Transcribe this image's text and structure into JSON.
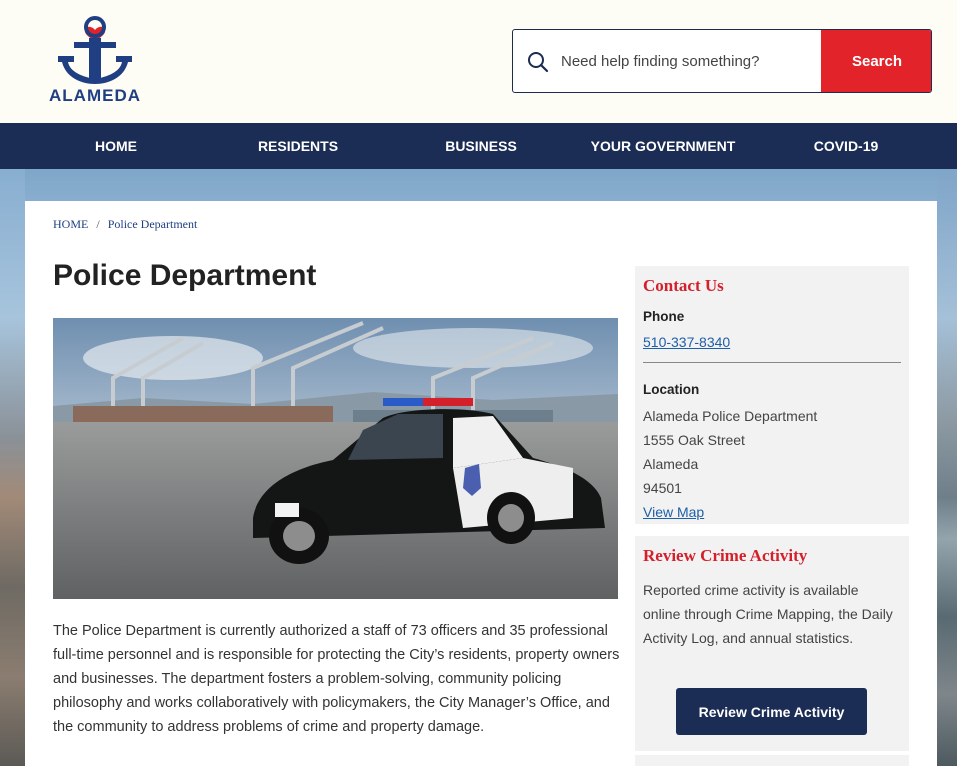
{
  "header": {
    "logo_text": "ALAMEDA",
    "search": {
      "placeholder": "Need help finding something?",
      "button_label": "Search"
    }
  },
  "nav": {
    "items": [
      {
        "label": "HOME"
      },
      {
        "label": "RESIDENTS"
      },
      {
        "label": "BUSINESS"
      },
      {
        "label": "YOUR GOVERNMENT"
      },
      {
        "label": "COVID-19"
      }
    ]
  },
  "breadcrumb": {
    "home": "HOME",
    "separator": "/",
    "current": "Police Department"
  },
  "main": {
    "title": "Police Department",
    "body": "The Police Department is currently authorized a staff of 73 officers and 35 professional full-time personnel and is responsible for protecting the City’s residents, property owners and businesses. The department fosters a problem-solving, community policing philosophy and works collaboratively with policymakers, the City Manager’s Office, and the community to address problems of crime and property damage."
  },
  "sidebar": {
    "contact": {
      "title": "Contact Us",
      "phone_label": "Phone",
      "phone": "510-337-8340",
      "location_label": "Location",
      "address_lines": [
        "Alameda Police Department",
        "1555 Oak Street",
        "Alameda",
        "94501"
      ],
      "map_link": "View Map"
    },
    "crime": {
      "title": "Review Crime Activity",
      "text": "Reported crime activity is available online through Crime Mapping, the Daily Activity Log, and annual statistics.",
      "button_label": "Review Crime Activity"
    }
  },
  "colors": {
    "brand_navy": "#1b2c55",
    "accent_red": "#e2232a",
    "heading_red": "#d4202b",
    "link_blue": "#1e5fa8"
  },
  "icons": {
    "search": "search-icon",
    "logo": "anchor-heart-logo"
  }
}
